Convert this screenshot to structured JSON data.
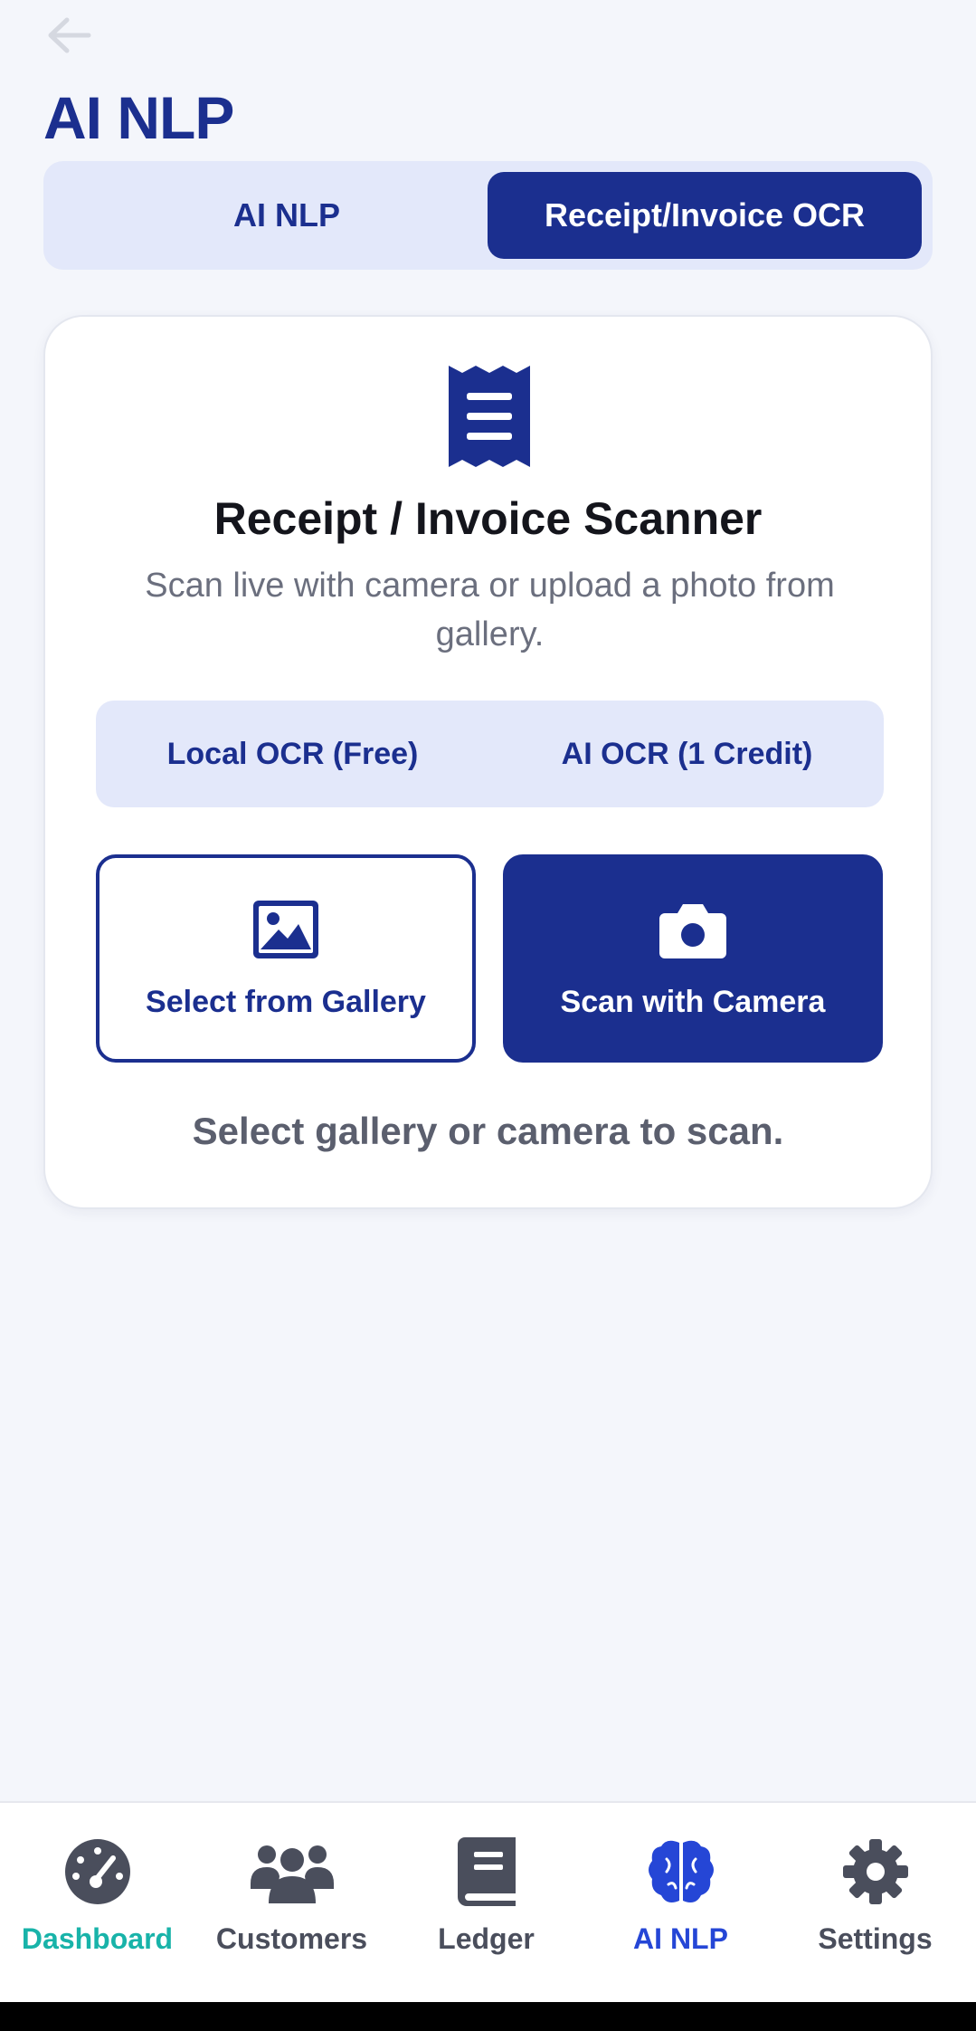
{
  "header": {
    "title": "AI NLP",
    "back_icon": "arrow-left-icon"
  },
  "mode_tabs": [
    {
      "label": "AI NLP",
      "selected": false
    },
    {
      "label": "Receipt/Invoice OCR",
      "selected": true
    }
  ],
  "scanner_card": {
    "icon": "receipt-icon",
    "title": "Receipt / Invoice Scanner",
    "subtitle": "Scan live with camera or upload a photo from gallery.",
    "ocr_options": [
      {
        "label": "Local OCR (Free)"
      },
      {
        "label": "AI OCR (1 Credit)"
      }
    ],
    "gallery_button": {
      "label": "Select from Gallery",
      "icon": "image-icon"
    },
    "camera_button": {
      "label": "Scan with Camera",
      "icon": "camera-icon"
    },
    "hint": "Select gallery or camera to scan."
  },
  "bottom_nav": [
    {
      "label": "Dashboard",
      "icon": "speedometer-icon"
    },
    {
      "label": "Customers",
      "icon": "users-icon"
    },
    {
      "label": "Ledger",
      "icon": "book-icon"
    },
    {
      "label": "AI NLP",
      "icon": "brain-icon",
      "active": true
    },
    {
      "label": "Settings",
      "icon": "gear-icon"
    }
  ],
  "colors": {
    "primary": "#1b2f8f",
    "segment_bg": "#e3e8fa",
    "page_bg": "#f4f6fb",
    "nav_active": "#2546d6",
    "nav_dashboard": "#18b3a9",
    "nav_inactive": "#4a4e5c"
  }
}
